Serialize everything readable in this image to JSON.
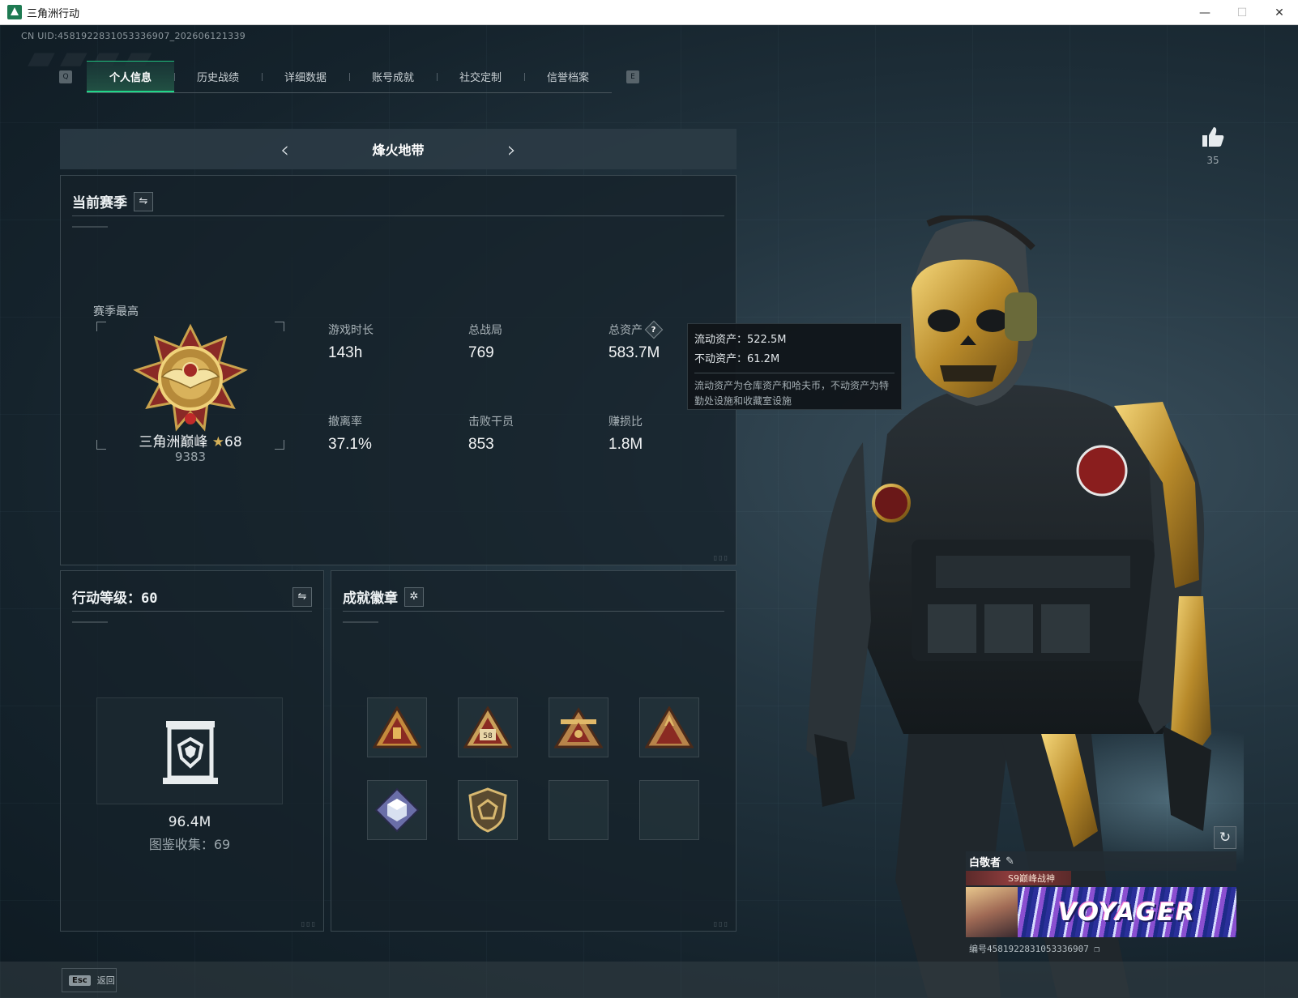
{
  "window": {
    "title": "三角洲行动",
    "controls": [
      "—",
      "☐",
      "✕"
    ]
  },
  "uid_text": "CN UID:4581922831053336907_202606121339",
  "tabs": [
    {
      "label": "个人信息",
      "active": true
    },
    {
      "label": "历史战绩",
      "active": false
    },
    {
      "label": "详细数据",
      "active": false
    },
    {
      "label": "账号成就",
      "active": false
    },
    {
      "label": "社交定制",
      "active": false
    },
    {
      "label": "信誉档案",
      "active": false
    }
  ],
  "tab_keys": {
    "left": "Q",
    "right": "E"
  },
  "mode_selector": {
    "name": "烽火地带",
    "prev_icon": "chevron-left-icon",
    "next_icon": "chevron-right-icon"
  },
  "season_panel": {
    "title": "当前赛季",
    "season_best_label": "赛季最高",
    "rank_name": "三角洲巅峰",
    "rank_star": "★",
    "rank_stars_count": "68",
    "rank_score": "9383",
    "stats": [
      {
        "label": "游戏时长",
        "value": "143h"
      },
      {
        "label": "总战局",
        "value": "769"
      },
      {
        "label": "总资产",
        "value": "583.7M",
        "help": "?"
      },
      {
        "label": "撤离率",
        "value": "37.1%"
      },
      {
        "label": "击败干员",
        "value": "853"
      },
      {
        "label": "赚损比",
        "value": "1.8M"
      }
    ]
  },
  "tooltip": {
    "liquid": "流动资产：522.5M",
    "fixed": "不动资产：61.2M",
    "note": "流动资产为仓库资产和哈夫币，不动资产为特勤处设施和收藏室设施"
  },
  "level_panel": {
    "title": "行动等级：",
    "level": "60",
    "collection_value": "96.4M",
    "collection_label": "图鉴收集：69"
  },
  "badge_panel": {
    "title": "成就徽章",
    "badge_58_text": "58"
  },
  "likes": {
    "count": "35"
  },
  "player_card": {
    "name": "白敬者",
    "title": "S9巅峰战神",
    "banner_text": "VOYAGER",
    "id_text": "编号4581922831053336907"
  },
  "bottom": {
    "esc_key": "Esc",
    "back_label": "返回"
  },
  "colors": {
    "accent_green": "#1fd689",
    "gold": "#d6b158",
    "panel_bg": "#16222a"
  }
}
